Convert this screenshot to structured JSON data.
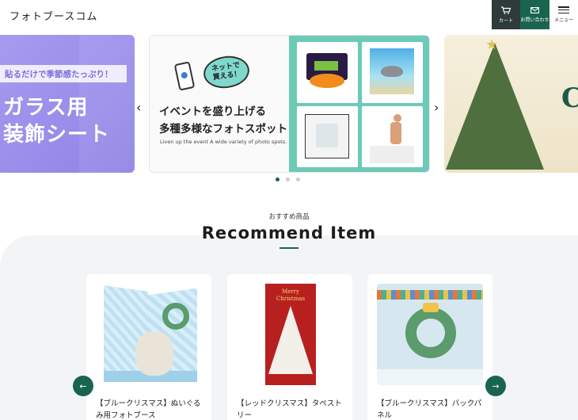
{
  "header": {
    "logo": "フォトブースコム",
    "cart_label": "カート",
    "contact_label": "お問い合わせ",
    "menu_label": "メニュー"
  },
  "hero": {
    "slides": [
      {
        "tagline": "貼るだけで季節感たっぷり！",
        "title_line1": "ガラス用",
        "title_line2": "装飾シート"
      },
      {
        "bubble": "ネットで\n買える！",
        "title_line1": "イベントを盛り上げる",
        "title_line2": "多種多様なフォトスポット",
        "subtitle": "Liven up the event A wide variety of photo spots."
      },
      {
        "letter": "C"
      }
    ],
    "prev_arrow": "‹",
    "next_arrow": "›",
    "active_dot": 0,
    "dot_count": 3
  },
  "recommend": {
    "subtitle": "おすすめ商品",
    "title": "Recommend Item",
    "products": [
      {
        "name": "【ブルークリスマス】ぬいぐるみ用フォトブース"
      },
      {
        "name": "【レッドクリスマス】タペストリー",
        "thumb_text": "Merry\nChristmas"
      },
      {
        "name": "【ブルークリスマス】バックパネル"
      }
    ],
    "prev_arrow": "←",
    "next_arrow": "→"
  },
  "colors": {
    "accent": "#19644f",
    "cart_bg": "#2e3b38",
    "slide_purple": "#a79cf0",
    "slide_teal": "#6dcab6"
  },
  "icons": [
    "cart-icon",
    "mail-icon",
    "menu-icon",
    "chevron-left-icon",
    "chevron-right-icon",
    "arrow-left-icon",
    "arrow-right-icon"
  ]
}
